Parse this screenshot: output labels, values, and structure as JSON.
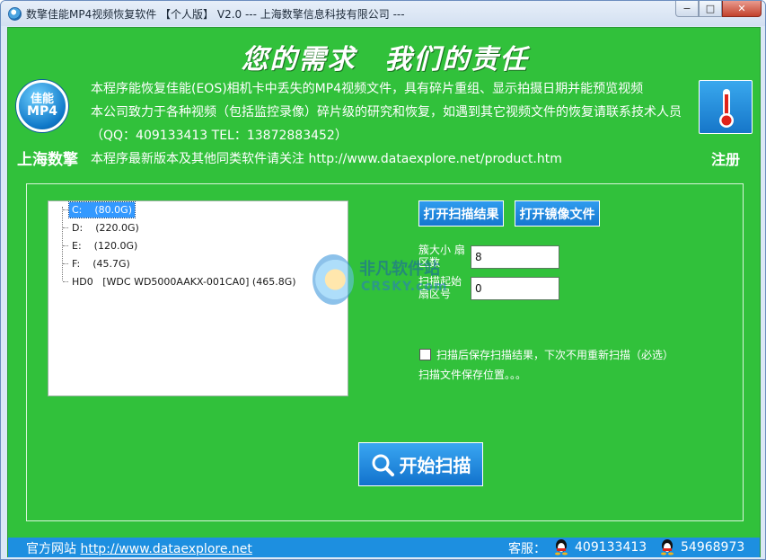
{
  "window": {
    "title": "数擎佳能MP4视频恢复软件 【个人版】 V2.0 --- 上海数擎信息科技有限公司 ---",
    "min_glyph": "−",
    "max_glyph": "□",
    "close_glyph": "✕"
  },
  "header": {
    "slogan": "您的需求　我们的责任",
    "logo_line1": "佳能",
    "logo_line2": "MP4",
    "company": "上海数擎",
    "desc_line1": "本程序能恢复佳能(EOS)相机卡中丢失的MP4视频文件，具有碎片重组、显示拍摄日期并能预览视频",
    "desc_line2": "本公司致力于各种视频（包括监控录像）碎片级的研究和恢复，如遇到其它视频文件的恢复请联系技术人员（QQ：409133413  TEL：13872883452）",
    "desc_line3": "本程序最新版本及其他同类软件请关注 http://www.dataexplore.net/product.htm",
    "register_label": "注册",
    "register_icon": "thermometer-icon"
  },
  "drives": [
    {
      "name": "C:",
      "size": "(80.0G)",
      "selected": true
    },
    {
      "name": "D:",
      "size": "(220.0G)",
      "selected": false
    },
    {
      "name": "E:",
      "size": "(120.0G)",
      "selected": false
    },
    {
      "name": "F:",
      "size": "(45.7G)",
      "selected": false
    },
    {
      "name": "HD0",
      "size": "[WDC WD5000AAKX-001CA0]  (465.8G)",
      "selected": false
    }
  ],
  "controls": {
    "open_result_label": "打开扫描结果",
    "open_image_label": "打开镜像文件",
    "cluster_label": "簇大小 扇区数",
    "cluster_value": "8",
    "start_sector_label": "扫描起始扇区号",
    "start_sector_value": "0",
    "save_checkbox_label": "扫描后保存扫描结果，下次不用重新扫描（必选）",
    "save_path_label": "扫描文件保存位置。。。",
    "scan_button_label": "开始扫描"
  },
  "watermark": {
    "text1": "非凡软件站",
    "text2": "CRSKY.com"
  },
  "footer": {
    "site_prefix": "官方网站",
    "site_url": "http://www.dataexplore.net",
    "service_label": "客服：",
    "qq1": "409133413",
    "qq2": "54968973"
  },
  "colors": {
    "client_bg": "#31c13b",
    "button_blue": "#1d8fe0",
    "footer_bg": "#1d8fe0"
  }
}
